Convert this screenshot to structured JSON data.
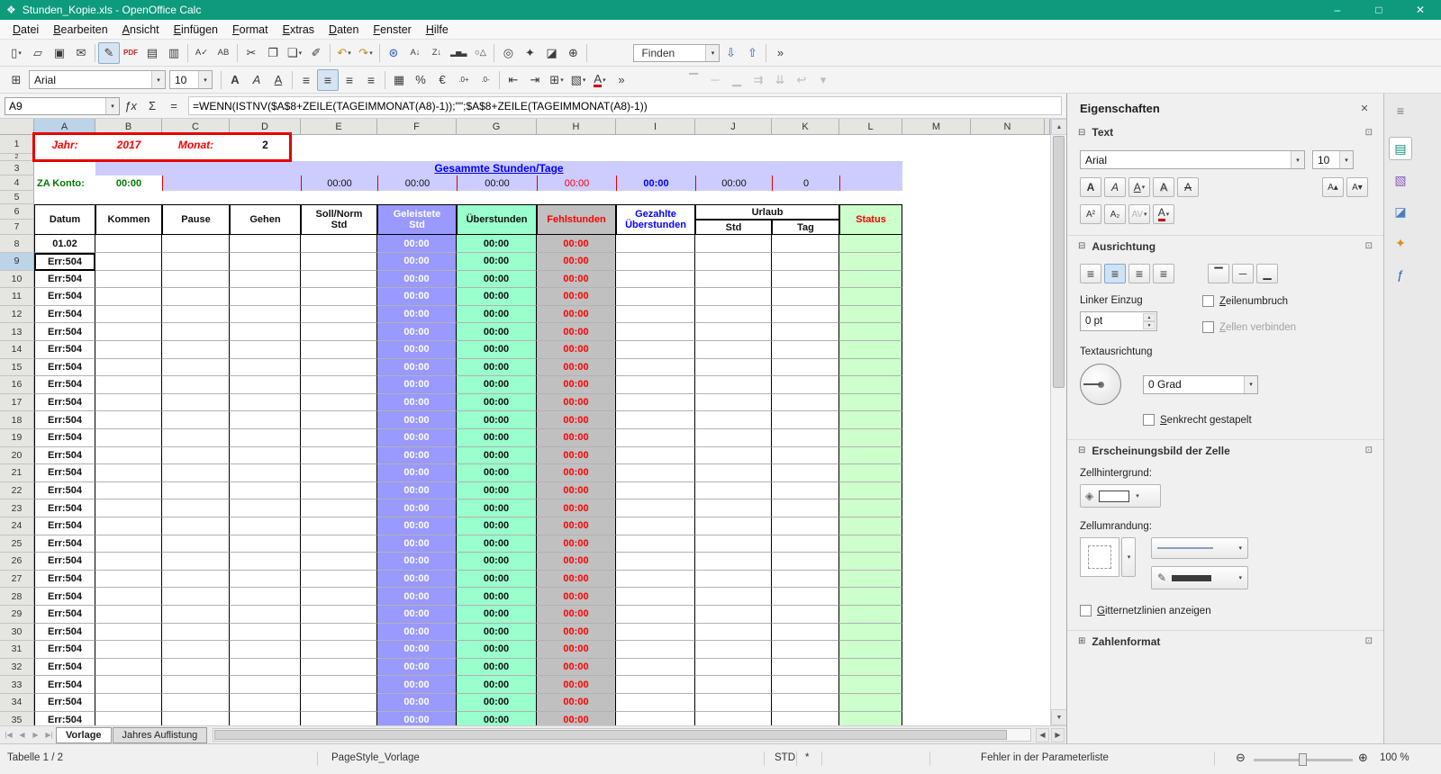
{
  "window": {
    "title": "Stunden_Kopie.xls - OpenOffice Calc",
    "app_icon_glyph": "❖",
    "minimize_glyph": "–",
    "maximize_glyph": "□",
    "close_glyph": "✕"
  },
  "menu": {
    "items": [
      "Datei",
      "Bearbeiten",
      "Ansicht",
      "Einfügen",
      "Format",
      "Extras",
      "Daten",
      "Fenster",
      "Hilfe"
    ]
  },
  "glyphs": {
    "dropdown": "▾",
    "collapse": "⊟",
    "expand": "⊞",
    "launcher": "⊡",
    "close": "✕",
    "up_arrow": "▲",
    "down_arrow": "▼",
    "left_arrow": "◀",
    "right_arrow": "▶",
    "overflow": "»",
    "spin_up": "▲",
    "spin_down": "▼"
  },
  "toolbar_standard": {
    "items": [
      {
        "name": "new-icon",
        "glyph": "▯",
        "dropdown": true
      },
      {
        "name": "open-icon",
        "glyph": "▱"
      },
      {
        "name": "save-icon",
        "glyph": "▣"
      },
      {
        "name": "send-email-icon",
        "glyph": "✉"
      },
      {
        "sep": true
      },
      {
        "name": "edit-file-icon",
        "glyph": "✎",
        "active": true
      },
      {
        "name": "export-pdf-icon",
        "glyph": "PDF",
        "cls": "redtxt"
      },
      {
        "name": "print-icon",
        "glyph": "▤"
      },
      {
        "name": "page-preview-icon",
        "glyph": "▥"
      },
      {
        "sep": true
      },
      {
        "name": "spellcheck-icon",
        "glyph": "A✓"
      },
      {
        "name": "autospellcheck-icon",
        "glyph": "AB"
      },
      {
        "sep": true
      },
      {
        "name": "cut-icon",
        "glyph": "✂"
      },
      {
        "name": "copy-icon",
        "glyph": "❐"
      },
      {
        "name": "paste-icon",
        "glyph": "❏",
        "dropdown": true
      },
      {
        "name": "format-paintbrush-icon",
        "glyph": "✐"
      },
      {
        "sep": true
      },
      {
        "name": "undo-icon",
        "glyph": "↶",
        "cls": "gold",
        "dropdown": true
      },
      {
        "name": "redo-icon",
        "glyph": "↷",
        "cls": "gold",
        "dropdown": true
      },
      {
        "sep": true
      },
      {
        "name": "hyperlink-icon",
        "glyph": "⊛",
        "cls": "bluetxt"
      },
      {
        "name": "sort-ascending-icon",
        "glyph": "A↓"
      },
      {
        "name": "sort-descending-icon",
        "glyph": "Z↓"
      },
      {
        "name": "insert-chart-icon",
        "glyph": "▂▅▃"
      },
      {
        "name": "draw-functions-icon",
        "glyph": "○△"
      },
      {
        "sep": true
      },
      {
        "name": "find-replace-icon",
        "glyph": "◎"
      },
      {
        "name": "navigator-icon",
        "glyph": "✦"
      },
      {
        "name": "gallery-icon",
        "glyph": "◪"
      },
      {
        "name": "zoom-icon",
        "glyph": "⊕"
      },
      {
        "sep": true
      }
    ],
    "find_value": "Finden",
    "find_down_glyph": "⇩",
    "find_up_glyph": "⇧"
  },
  "toolbar_format": {
    "lead_icon": {
      "name": "table-grid-icon",
      "glyph": "⊞"
    },
    "font_name": "Arial",
    "font_size": "10",
    "items": [
      {
        "sep": true
      },
      {
        "name": "bold-button",
        "glyph": "A",
        "cls": "gb-b"
      },
      {
        "name": "italic-button",
        "glyph": "A",
        "cls": "gb-i"
      },
      {
        "name": "underline-button",
        "glyph": "A",
        "cls": "gb-u"
      },
      {
        "sep": true
      },
      {
        "name": "align-left-icon",
        "glyph": "≡"
      },
      {
        "name": "align-center-icon",
        "glyph": "≡",
        "active": true
      },
      {
        "name": "align-right-icon",
        "glyph": "≡"
      },
      {
        "name": "align-justify-icon",
        "glyph": "≡"
      },
      {
        "sep": true
      },
      {
        "name": "merge-cells-icon",
        "glyph": "▦"
      },
      {
        "name": "number-percent-icon",
        "glyph": "%"
      },
      {
        "name": "number-currency-icon",
        "glyph": "€"
      },
      {
        "name": "add-decimal-icon",
        "glyph": ".0+"
      },
      {
        "name": "delete-decimal-icon",
        "glyph": ".0-"
      },
      {
        "sep": true
      },
      {
        "name": "decrease-indent-icon",
        "glyph": "⇤"
      },
      {
        "name": "increase-indent-icon",
        "glyph": "⇥"
      },
      {
        "name": "borders-icon",
        "glyph": "⊞",
        "dropdown": true
      },
      {
        "name": "background-color-icon",
        "glyph": "▧",
        "dropdown": true
      },
      {
        "name": "font-color-icon",
        "glyph": "A",
        "cls": "gb-fc",
        "dropdown": true
      },
      {
        "name": "toolbar-overflow-icon",
        "glyph": "»"
      }
    ],
    "disabled_items": [
      {
        "name": "align-top-icon",
        "glyph": "▔",
        "disabled": true
      },
      {
        "name": "align-vcenter-icon",
        "glyph": "─",
        "disabled": true
      },
      {
        "name": "align-bottom-icon",
        "glyph": "▁",
        "disabled": true
      },
      {
        "name": "text-direction-ltr-icon",
        "glyph": "⇉",
        "disabled": true
      },
      {
        "name": "text-direction-ttb-icon",
        "glyph": "⇊",
        "disabled": true
      },
      {
        "name": "wrap-text-icon",
        "glyph": "↩",
        "disabled": true
      },
      {
        "name": "toolbar-overflow2-icon",
        "glyph": "▾",
        "disabled": true
      }
    ]
  },
  "formula_bar": {
    "cell_ref": "A9",
    "fx_glyph": "ƒx",
    "sum_glyph": "Σ",
    "equals_glyph": "=",
    "formula": "=WENN(ISTNV($A$8+ZEILE(TAGEIMMONAT(A8)-1));\"\";$A$8+ZEILE(TAGEIMMONAT(A8)-1))"
  },
  "grid": {
    "columns": [
      "A",
      "B",
      "C",
      "D",
      "E",
      "F",
      "G",
      "H",
      "I",
      "J",
      "K",
      "L",
      "M",
      "N"
    ],
    "row_count": 35,
    "banner": {
      "jahr_label": "Jahr:",
      "jahr_value": "2017",
      "monat_label": "Monat:",
      "monat_value": "2"
    },
    "summary_title": "Gesammte Stunden/Tage",
    "summary": {
      "za_label": "ZA Konto:",
      "za_value": "00:00",
      "e": "00:00",
      "f": "00:00",
      "g": "00:00",
      "h": "00:00",
      "i": "00:00",
      "j": "00:00",
      "k": "0"
    },
    "table_headers": {
      "datum": "Datum",
      "kommen": "Kommen",
      "pause": "Pause",
      "gehen": "Gehen",
      "soll_line1": "Soll/Norm",
      "soll_line2": "Std",
      "geleistete_line1": "Geleistete",
      "geleistete_line2": "Std",
      "ueberstunden": "Überstunden",
      "fehlstunden": "Fehlstunden",
      "gezahlte_line1": "Gezahlte",
      "gezahlte_line2": "Überstunden",
      "urlaub": "Urlaub",
      "urlaub_std": "Std",
      "urlaub_tag": "Tag",
      "status": "Status"
    },
    "cells": {
      "first_date": "01.02",
      "error_value": "Err:504",
      "time_value": "00:00",
      "selected": "A9"
    }
  },
  "sheet_tabs": {
    "nav_glyphs": [
      "|◀",
      "◀",
      "▶",
      "▶|"
    ],
    "tabs": [
      {
        "label": "Vorlage",
        "active": true
      },
      {
        "label": "Jahres Auflistung",
        "active": false
      }
    ]
  },
  "status_bar": {
    "sheet_info": "Tabelle 1 / 2",
    "page_style": "PageStyle_Vorlage",
    "insert_mode": "STD",
    "modified_flag": "*",
    "message": "Fehler in der Parameterliste",
    "zoom_out_glyph": "⊖",
    "zoom_in_glyph": "⊕",
    "zoom_value": "100 %"
  },
  "sidebar": {
    "title": "Eigenschaften",
    "text": {
      "label": "Text",
      "font_name": "Arial",
      "font_size": "10",
      "buttons_row1": [
        {
          "name": "sidebar-bold-button",
          "glyph": "A",
          "cls": "gb-b"
        },
        {
          "name": "sidebar-italic-button",
          "glyph": "A",
          "cls": "gb-i"
        },
        {
          "name": "sidebar-underline-button",
          "glyph": "A",
          "cls": "gb-u",
          "dropdown": true
        },
        {
          "name": "sidebar-shadow-button",
          "glyph": "A",
          "cls": "gb-sh"
        },
        {
          "name": "sidebar-strikethrough-button",
          "glyph": "A",
          "cls": "gb-st"
        }
      ],
      "buttons_row1_right": [
        {
          "name": "sidebar-increase-font-button",
          "glyph": "A▴"
        },
        {
          "name": "sidebar-decrease-font-button",
          "glyph": "A▾"
        }
      ],
      "buttons_row2": [
        {
          "name": "sidebar-superscript-button",
          "glyph": "A²"
        },
        {
          "name": "sidebar-subscript-button",
          "glyph": "A₂"
        },
        {
          "name": "sidebar-char-spacing-button",
          "glyph": "AV",
          "dropdown": true,
          "disabled": true
        },
        {
          "name": "sidebar-font-color-button",
          "glyph": "A",
          "cls": "gb-fc",
          "dropdown": true
        }
      ]
    },
    "alignment": {
      "label": "Ausrichtung",
      "h_buttons": [
        {
          "name": "sidebar-align-left-button",
          "glyph": "≡"
        },
        {
          "name": "sidebar-align-center-button",
          "glyph": "≡",
          "active": true
        },
        {
          "name": "sidebar-align-right-button",
          "glyph": "≡"
        },
        {
          "name": "sidebar-align-justify-button",
          "glyph": "≡"
        }
      ],
      "v_buttons": [
        {
          "name": "sidebar-align-top-button",
          "glyph": "▔"
        },
        {
          "name": "sidebar-align-middle-button",
          "glyph": "─"
        },
        {
          "name": "sidebar-align-bottom-button",
          "glyph": "▁"
        }
      ],
      "indent_label": "Linker Einzug",
      "indent_value": "0 pt",
      "wrap_label": "Zeilenumbruch",
      "merge_label": "Zellen verbinden",
      "orient_label": "Textausrichtung",
      "degree_value": "0 Grad",
      "stacked_label": "Senkrecht gestapelt"
    },
    "appearance": {
      "label": "Erscheinungsbild der Zelle",
      "bg_label": "Zellhintergrund:",
      "border_label": "Zellumrandung:",
      "gridlines_label": "Gitternetzlinien anzeigen",
      "bucket_glyph": "◈",
      "pencil_glyph": "✎"
    },
    "number": {
      "label": "Zahlenformat"
    }
  },
  "tabstrip": {
    "items": [
      {
        "name": "sidebar-settings-icon",
        "glyph": "≡",
        "color": "#777777"
      },
      {
        "name": "deck-properties-icon",
        "glyph": "▤",
        "color": "#0B8F78",
        "active": true
      },
      {
        "name": "deck-styles-icon",
        "glyph": "▧",
        "color": "#8A5AB8"
      },
      {
        "name": "deck-gallery-icon",
        "glyph": "◪",
        "color": "#4A7EC2"
      },
      {
        "name": "deck-navigator-icon",
        "glyph": "✦",
        "color": "#E08A1E"
      },
      {
        "name": "deck-functions-icon",
        "glyph": "ƒ",
        "color": "#2A62B8"
      }
    ]
  },
  "colors": {
    "titlebar": "#0E9A7C",
    "lavender": "#CCCCFF",
    "purple": "#9999FF",
    "mint": "#99FFCC",
    "graycol": "#C0C0C0",
    "statusgreen": "#CCFFCC",
    "red": "#FF0000",
    "green": "#007A00",
    "blue": "#0000FF",
    "header_sel": "#BCD3E8"
  }
}
